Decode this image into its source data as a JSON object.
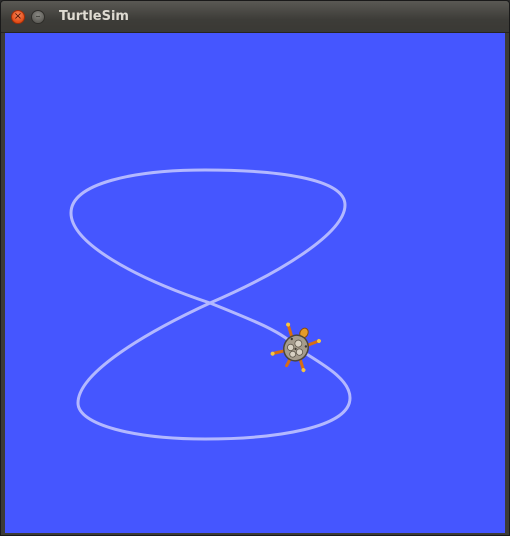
{
  "window": {
    "title": "TurtleSim",
    "controls": [
      {
        "name": "close",
        "icon": "close-icon",
        "glyph": "×"
      },
      {
        "name": "minimize",
        "icon": "minimize-icon",
        "glyph": "–"
      }
    ]
  },
  "canvas": {
    "background_color": "#4556ff",
    "pen_color": "#b3b8ff",
    "turtle_icon": "turtle-icon"
  }
}
